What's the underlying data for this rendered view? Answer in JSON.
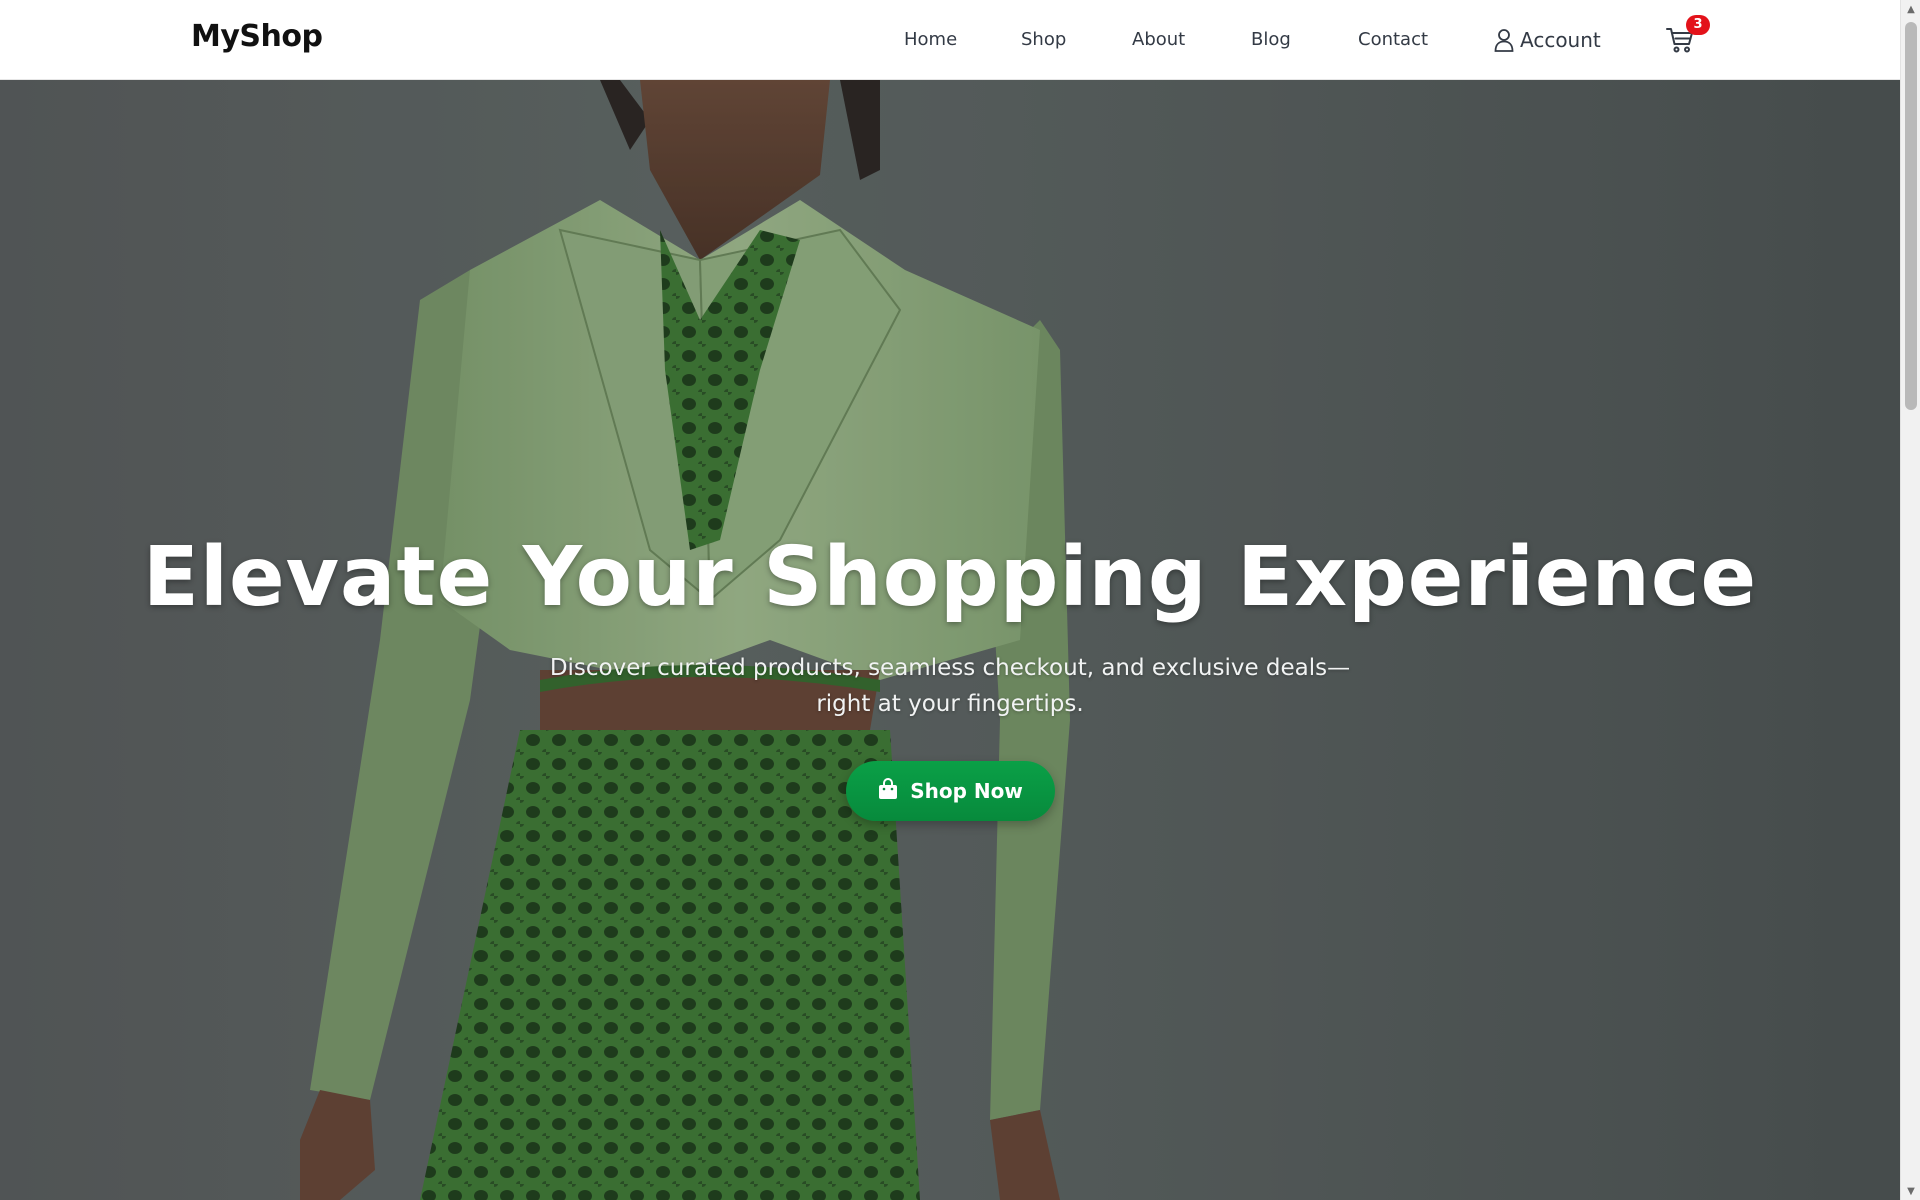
{
  "navbar": {
    "brand": "MyShop",
    "links": [
      "Home",
      "Shop",
      "About",
      "Blog",
      "Contact"
    ],
    "account_label": "Account",
    "account_icon": "user-icon",
    "cart_icon": "cart-icon",
    "cart_count": "3"
  },
  "hero": {
    "title": "Elevate Your Shopping Experience",
    "subtitle": "Discover curated products, seamless checkout, and exclusive deals—right at your fingertips.",
    "cta_label": "Shop Now",
    "cta_icon": "shopping-bag-icon"
  },
  "colors": {
    "accent": "#0a9a44",
    "badge": "#e3121a",
    "nav_text": "#333a45"
  }
}
